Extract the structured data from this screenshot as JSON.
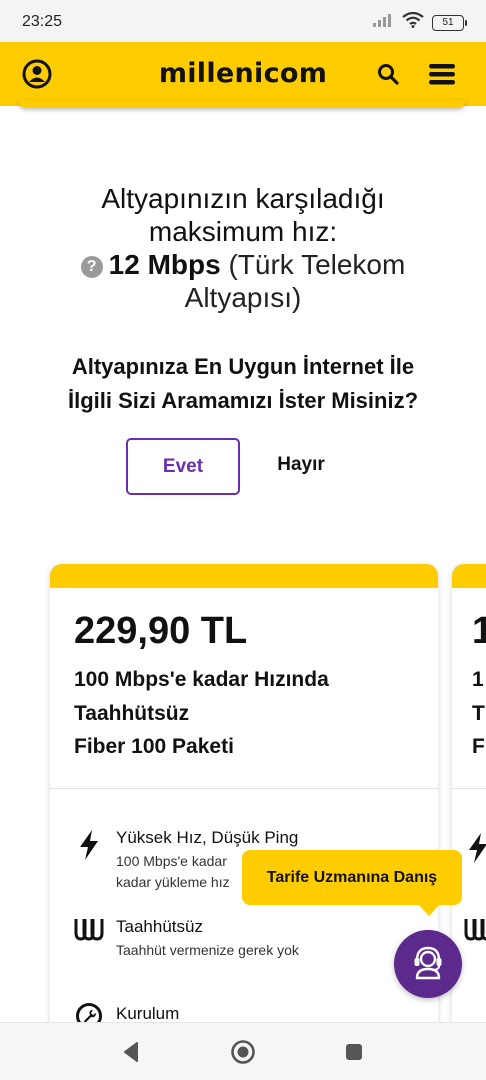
{
  "status_bar": {
    "time": "23:25",
    "battery": "51"
  },
  "header": {
    "logo": "millenicom"
  },
  "speed": {
    "title_line1": "Altyapınızın karşıladığı",
    "title_line2": "maksimum hız:",
    "value": "12 Mbps",
    "provider_part1": "(Türk Telekom",
    "provider_part2": "Altyapısı)"
  },
  "callback": {
    "question_line1": "Altyapınıza En Uygun İnternet İle",
    "question_line2": "İlgili Sizi Aramamızı İster Misiniz?",
    "yes_label": "Evet",
    "no_label": "Hayır"
  },
  "card": {
    "price": "229,90 TL",
    "name_line1": "100 Mbps'e kadar Hızında",
    "name_line2": "Taahhütsüz",
    "name_line3": "Fiber 100 Paketi",
    "features": [
      {
        "icon": "lightning-icon",
        "title": "Yüksek Hız, Düşük Ping",
        "desc_line1": "100 Mbps'e kadar",
        "desc_line2": "kadar yükleme hız"
      },
      {
        "icon": "no-commitment-icon",
        "title": "Taahhütsüz",
        "desc_line1": "Taahhüt vermenize gerek yok"
      },
      {
        "icon": "installation-icon",
        "title": "Kurulum"
      }
    ]
  },
  "next_card": {
    "price_fragment": "1",
    "line1_fragment": "1",
    "line2_fragment": "T",
    "line3_fragment": "F"
  },
  "tooltip": {
    "label": "Tarife Uzmanına Danış"
  },
  "colors": {
    "brand_yellow": "#ffcc00",
    "brand_purple": "#5b2a8c",
    "button_purple": "#6a2fb0"
  }
}
